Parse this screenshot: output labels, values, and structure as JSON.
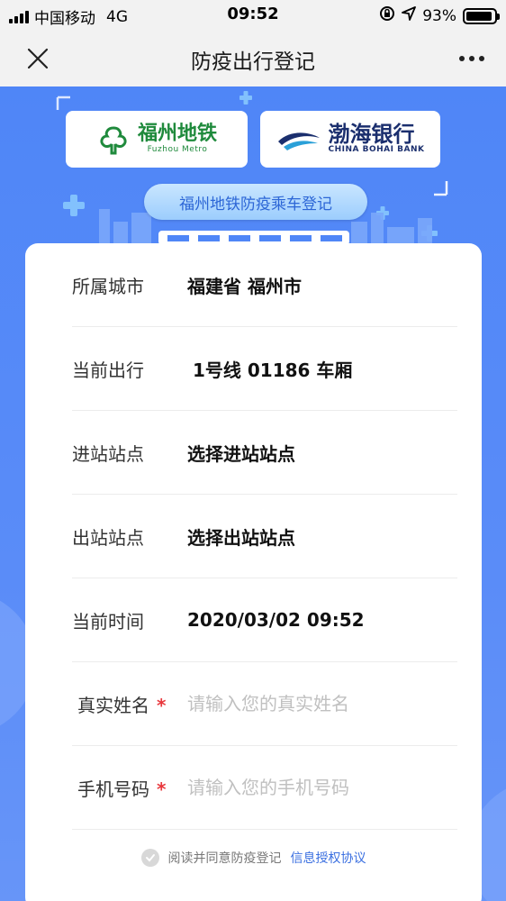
{
  "status_bar": {
    "carrier": "中国移动",
    "network": "4G",
    "time": "09:52",
    "battery": "93%",
    "battery_level": 0.93
  },
  "nav": {
    "title": "防疫出行登记",
    "close_icon": "close-icon",
    "more_icon": "more-icon"
  },
  "banner": {
    "metro_logo": {
      "cn": "福州地铁",
      "en": "Fuzhou Metro"
    },
    "bank_logo": {
      "cn": "渤海银行",
      "en": "CHINA BOHAI BANK"
    },
    "pill_text": "福州地铁防疫乘车登记"
  },
  "form": {
    "rows": [
      {
        "label": "所属城市",
        "value": "福建省 福州市"
      },
      {
        "label": "当前出行",
        "value": "1号线 01186 车厢"
      },
      {
        "label": "进站站点",
        "value": "选择进站站点"
      },
      {
        "label": "出站站点",
        "value": "选择出站站点"
      },
      {
        "label": "当前时间",
        "value": "2020/03/02 09:52"
      }
    ],
    "name_field": {
      "label": "真实姓名",
      "required": "*",
      "placeholder": "请输入您的真实姓名"
    },
    "phone_field": {
      "label": "手机号码",
      "required": "*",
      "placeholder": "请输入您的手机号码"
    },
    "agreement": {
      "text": "阅读并同意防疫登记",
      "link": "信息授权协议"
    }
  },
  "colors": {
    "banner_blue": "#4f86f7",
    "link_blue": "#3a6fe0",
    "required_red": "#e8383d"
  }
}
